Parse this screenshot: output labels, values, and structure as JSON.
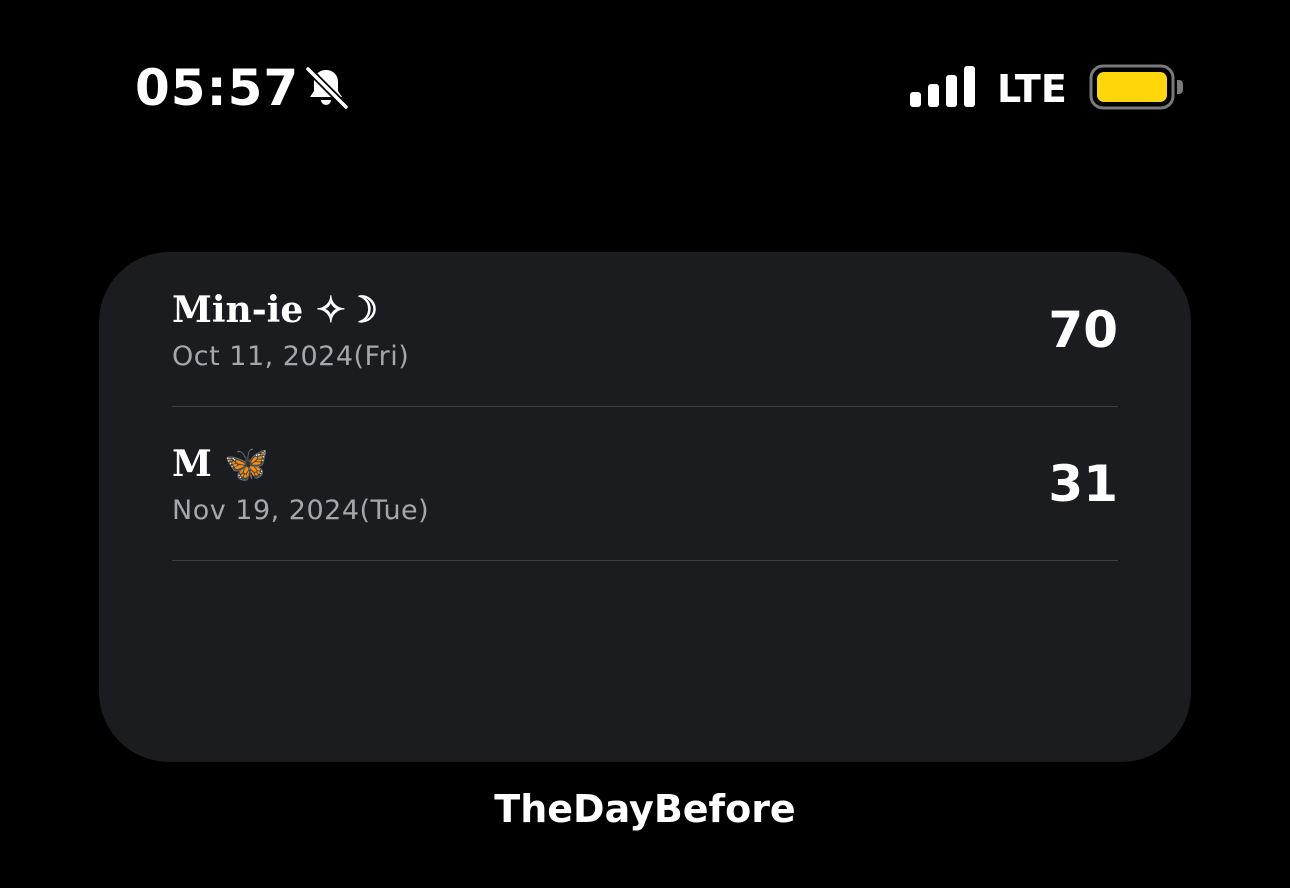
{
  "status_bar": {
    "time": "05:57",
    "network": "LTE",
    "icons": [
      "bell-slash-icon",
      "signal-icon",
      "battery-icon"
    ],
    "battery_color": "#ffd60a"
  },
  "widget": {
    "events": [
      {
        "title": "Min-ie ✧☽",
        "date": "Oct 11, 2024(Fri)",
        "count": "70"
      },
      {
        "title": "M 🦋",
        "date": "Nov 19, 2024(Tue)",
        "count": "31"
      }
    ]
  },
  "app_label": "TheDayBefore"
}
